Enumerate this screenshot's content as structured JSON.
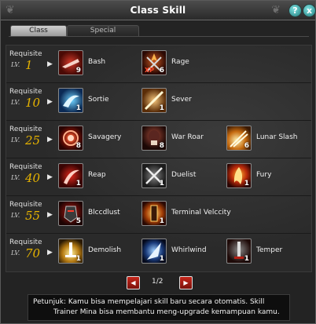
{
  "window": {
    "title": "Class Skill",
    "help_label": "?",
    "close_label": "x"
  },
  "tabs": [
    {
      "label": "Class",
      "active": true
    },
    {
      "label": "Special",
      "active": false
    }
  ],
  "requisite_label": "Requisite",
  "lv_label": "LV.",
  "rows": [
    {
      "level": "1",
      "skills": [
        {
          "name": "Bash",
          "count": "9",
          "icon": "bash-icon"
        },
        {
          "name": "Rage",
          "count": "6",
          "icon": "rage-icon",
          "badge": "XP"
        }
      ]
    },
    {
      "level": "10",
      "skills": [
        {
          "name": "Sortie",
          "count": "1",
          "icon": "sortie-icon"
        },
        {
          "name": "Sever",
          "count": "1",
          "icon": "sever-icon"
        }
      ]
    },
    {
      "level": "25",
      "skills": [
        {
          "name": "Savagery",
          "count": "8",
          "icon": "savagery-icon"
        },
        {
          "name": "War Roar",
          "count": "8",
          "icon": "war-roar-icon"
        },
        {
          "name": "Lunar Slash",
          "count": "6",
          "icon": "lunar-slash-icon"
        }
      ]
    },
    {
      "level": "40",
      "skills": [
        {
          "name": "Reap",
          "count": "1",
          "icon": "reap-icon"
        },
        {
          "name": "Duelist",
          "count": "1",
          "icon": "duelist-icon"
        },
        {
          "name": "Fury",
          "count": "1",
          "icon": "fury-icon"
        }
      ]
    },
    {
      "level": "55",
      "skills": [
        {
          "name": "Blccdlust",
          "count": "5",
          "icon": "bloodlust-icon"
        },
        {
          "name": "Terminal Velccity",
          "count": "1",
          "icon": "terminal-velocity-icon"
        }
      ]
    },
    {
      "level": "70",
      "skills": [
        {
          "name": "Demolish",
          "count": "1",
          "icon": "demolish-icon"
        },
        {
          "name": "Whirlwind",
          "count": "1",
          "icon": "whirlwind-icon"
        },
        {
          "name": "Temper",
          "count": "1",
          "icon": "temper-icon"
        }
      ]
    }
  ],
  "pager": {
    "text": "1/2",
    "prev": "◀",
    "next": "▶"
  },
  "tip": {
    "line1": "Petunjuk: Kamu bisa mempelajari skill baru secara otomatis. Skill",
    "line2": "Trainer Mina bisa membantu meng-upgrade kemampuan kamu."
  },
  "colors": {
    "accent": "#e6b300",
    "button_teal": "#1f7e7e",
    "pager_red": "#c7261b"
  }
}
